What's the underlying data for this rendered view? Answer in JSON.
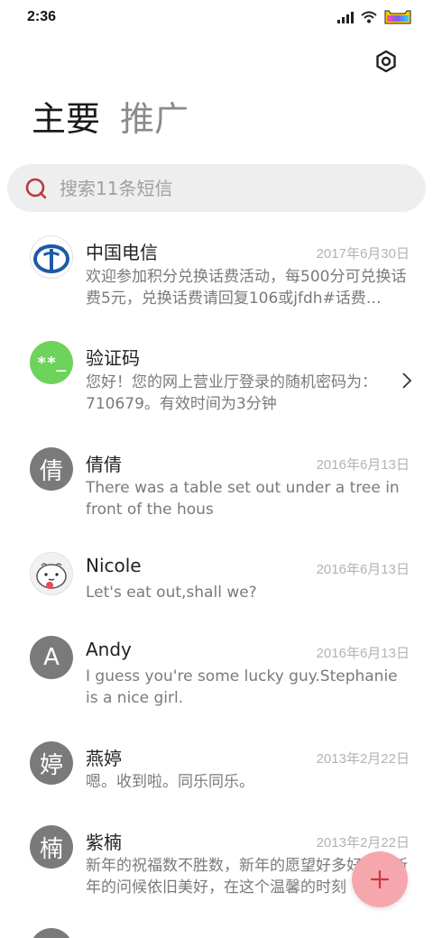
{
  "status_bar": {
    "time": "2:36",
    "icons": [
      "signal-icon",
      "wifi-icon",
      "battery-icon"
    ]
  },
  "header": {
    "settings_icon": "settings-icon",
    "tabs": [
      {
        "label": "主要",
        "active": true
      },
      {
        "label": "推广",
        "active": false
      }
    ]
  },
  "search": {
    "placeholder": "搜索11条短信",
    "icon": "search-icon",
    "accent": "#b83a3a"
  },
  "conversations": [
    {
      "name": "中国电信",
      "date": "2017年6月30日",
      "preview": "欢迎参加积分兑换话费活动，每500分可兑换话费5元，兑换话费请回复106或jfdh#话费…",
      "avatar": "china-telecom-logo",
      "avatar_text": ""
    },
    {
      "name": "验证码",
      "date": "",
      "preview": "您好！您的网上营业厅登录的随机密码为：710679。有效时间为3分钟",
      "avatar": "verification-code-avatar",
      "avatar_text": "**_"
    },
    {
      "name": "倩倩",
      "date": "2016年6月13日",
      "preview": "There was a table set out under a tree in front of the hous",
      "avatar": "letter-avatar",
      "avatar_text": "倩"
    },
    {
      "name": "Nicole",
      "date": "2016年6月13日",
      "preview": "Let's eat out,shall we?",
      "avatar": "cartoon-avatar",
      "avatar_text": ""
    },
    {
      "name": "Andy",
      "date": "2016年6月13日",
      "preview": "I guess you're some lucky guy.Stephanie is a nice girl.",
      "avatar": "letter-avatar",
      "avatar_text": "A"
    },
    {
      "name": "燕婷",
      "date": "2013年2月22日",
      "preview": "嗯。收到啦。同乐同乐。",
      "avatar": "letter-avatar",
      "avatar_text": "婷"
    },
    {
      "name": "紫楠",
      "date": "2013年2月22日",
      "preview": "新年的祝福数不胜数，新年的愿望好多好多，新年的问候依旧美好，在这个温馨的时刻",
      "avatar": "letter-avatar",
      "avatar_text": "楠"
    }
  ],
  "fab": {
    "label": "+",
    "color": "#f6a7ad",
    "icon_color": "#d0323d"
  },
  "colors": {
    "date": "#b3b3b3",
    "preview": "#7a7a7a",
    "avatar_gray": "#7a7a7a",
    "avatar_green": "#6dd35a"
  }
}
